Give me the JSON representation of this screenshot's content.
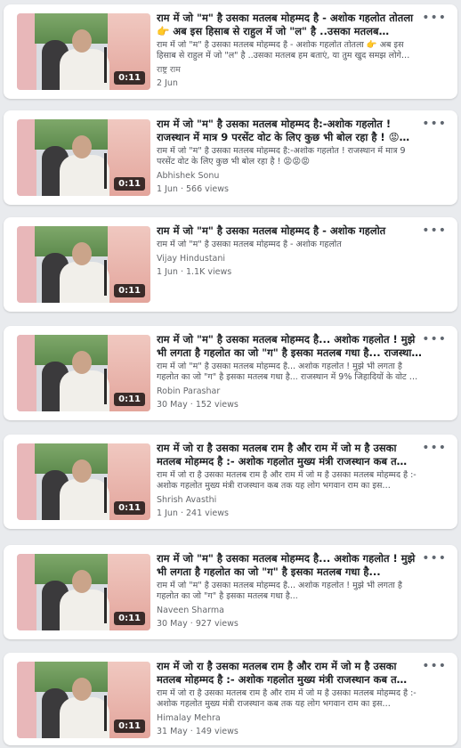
{
  "videos": [
    {
      "title": "राम में जो \"म\" है उसका मतलब मोहम्मद है - अशोक गहलोत तोतला 👉 अब इस हिसाब से राहुल में जो \"ल\" है ..उसका मतलब…",
      "description": "राम में जो \"म\" है उसका मतलब मोहम्मद है - अशोक गहलोत तोतला 👉 अब इस हिसाब से राहुल में जो \"ल\" है ..उसका मतलब हम बताएं, या तुम खुद समझ लोगे…",
      "author": "राष्ट्र राम",
      "date": "2 Jun",
      "views": "",
      "duration": "0:11"
    },
    {
      "title": "राम में जो \"म\" है उसका मतलब मोहम्मद है:-अशोक गहलोत ! राजस्थान में मात्र 9 परसेंट वोट के लिए कुछ भी बोल रहा है ! 😡…",
      "description": "राम में जो \"म\" है उसका मतलब मोहम्मद है:-अशोक गहलोत ! राजस्थान में मात्र 9 परसेंट वोट के लिए कुछ भी बोल रहा है ! 😡😡😡",
      "author": "Abhishek Sonu",
      "date": "1 Jun",
      "views": "566 views",
      "duration": "0:11"
    },
    {
      "title": "राम में जो \"म\" है उसका मतलब मोहम्मद है - अशोक गहलोत",
      "description": "राम में जो \"म\" है उसका मतलब मोहम्मद है - अशोक गहलोत",
      "author": "Vijay Hindustani",
      "date": "1 Jun",
      "views": "1.1K views",
      "duration": "0:11"
    },
    {
      "title": "राम में जो \"म\" है उसका मतलब मोहम्मद है... अशोक गहलोत ! मुझे भी लगता है गहलोत का जो \"ग\" है इसका मतलब गधा है... राजस्था…",
      "description": "राम में जो \"म\" है उसका मतलब मोहम्मद है... अशोक गहलोत ! मुझे भी लगता है गहलोत का जो \"ग\" है इसका मतलब गधा है... राजस्थान में 9% जिहादियों के वोट …",
      "author": "Robin Parashar",
      "date": "30 May",
      "views": "152 views",
      "duration": "0:11"
    },
    {
      "title": "राम में जो रा है उसका मतलब राम है और राम में जो म है उसका मतलब मोहम्मद है :- अशोक गहलोत मुख्य मंत्री राजस्थान कब त…",
      "description": "राम में जो रा है उसका मतलब राम है और राम में जो म है उसका मतलब मोहम्मद है :- अशोक गहलोत मुख्य मंत्री राजस्थान कब तक यह लोग भगवान राम का इस…",
      "author": "Shrish Avasthi",
      "date": "1 Jun",
      "views": "241 views",
      "duration": "0:11"
    },
    {
      "title": "राम में जो \"म\" है उसका मतलब मोहम्मद है... अशोक गहलोत ! मुझे भी लगता है गहलोत का जो \"ग\" है इसका मतलब गधा है...",
      "description": "राम में जो \"म\" है उसका मतलब मोहम्मद है... अशोक गहलोत ! मुझे भी लगता है गहलोत का जो \"ग\" है इसका मतलब गधा है...",
      "author": "Naveen Sharma",
      "date": "30 May",
      "views": "927 views",
      "duration": "0:11"
    },
    {
      "title": "राम में जो रा है उसका मतलब राम है और राम में जो म है उसका मतलब मोहम्मद है :- अशोक गहलोत मुख्य मंत्री राजस्थान कब त…",
      "description": "राम में जो रा है उसका मतलब राम है और राम में जो म है उसका मतलब मोहम्मद है :- अशोक गहलोत मुख्य मंत्री राजस्थान कब तक यह लोग भगवान राम का इस…",
      "author": "Himalay Mehra",
      "date": "31 May",
      "views": "149 views",
      "duration": "0:11"
    }
  ],
  "more_glyph": "•••",
  "meta_separator": " · "
}
